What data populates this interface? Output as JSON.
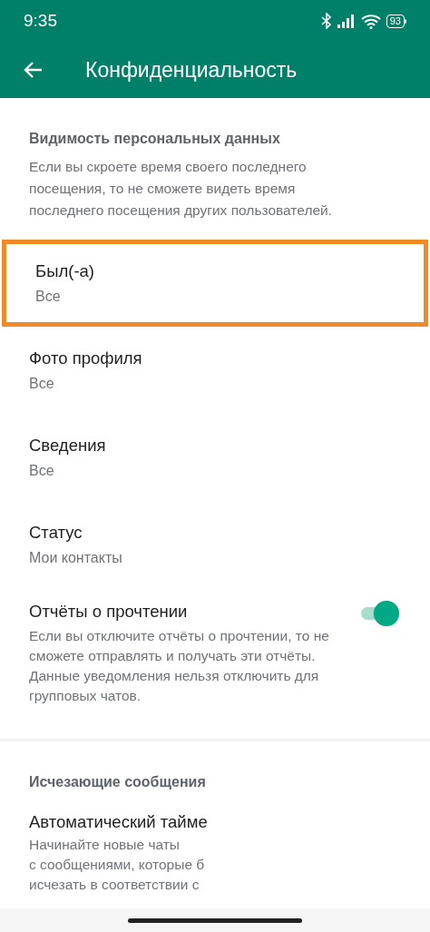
{
  "status_bar": {
    "time": "9:35",
    "battery": "93"
  },
  "toolbar": {
    "title": "Конфиденциальность"
  },
  "sections": [
    {
      "heading": "Видимость персональных данных",
      "description": "Если вы скроете время своего последнего посещения, то не сможете видеть время последнего посещения других пользователей.",
      "items": [
        {
          "kind": "choice",
          "title": "Был(-а)",
          "value": "Все",
          "highlighted": true
        },
        {
          "kind": "choice",
          "title": "Фото профиля",
          "value": "Все",
          "highlighted": false
        },
        {
          "kind": "choice",
          "title": "Сведения",
          "value": "Все",
          "highlighted": false
        },
        {
          "kind": "choice",
          "title": "Статус",
          "value": "Мои контакты",
          "highlighted": false
        },
        {
          "kind": "toggle",
          "title": "Отчёты о прочтении",
          "description": "Если вы отключите отчёты о прочтении, то не сможете отправлять и получать эти отчёты. Данные уведомления нельзя отключить для групповых чатов.",
          "on": true
        }
      ]
    },
    {
      "heading": "Исчезающие сообщения",
      "items": [
        {
          "kind": "partial",
          "title": "Автоматический тайме",
          "lines": [
            "Начинайте новые чаты",
            "с сообщениями, которые б",
            "исчезать в соответствии с"
          ]
        }
      ]
    }
  ]
}
